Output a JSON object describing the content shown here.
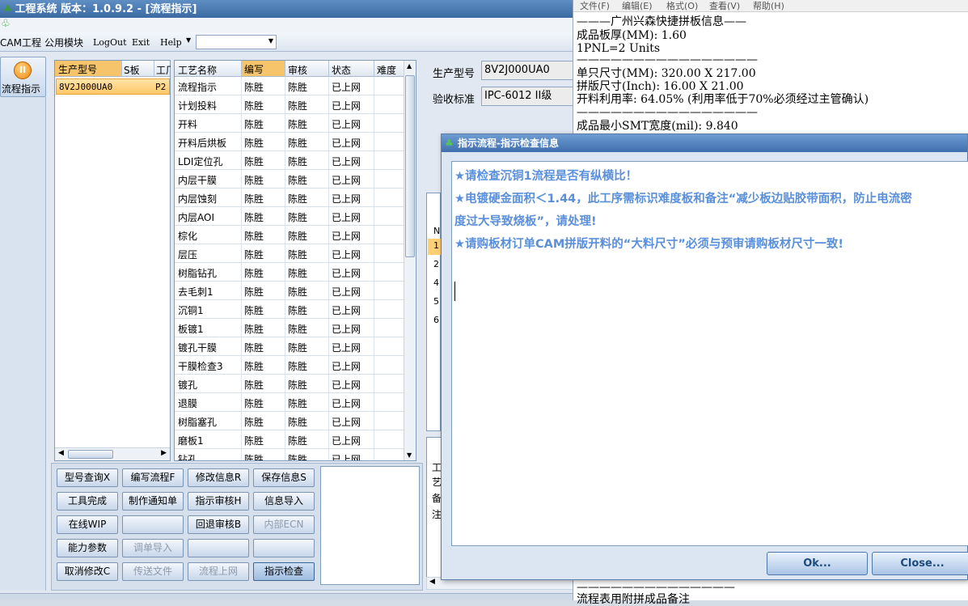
{
  "window": {
    "title": "工程系统    版本：1.0.9.2 - [流程指示]"
  },
  "menubar": {
    "items": [
      "CAM工程",
      "公用模块",
      "LogOut",
      "Exit",
      "Help"
    ]
  },
  "leftnav": {
    "label": "流程指示",
    "icon": "flow-icon"
  },
  "model_list": {
    "columns": [
      "生产型号",
      "S板",
      "工厂"
    ],
    "rows": [
      {
        "model": "8V2J000UA0",
        "s_board": "",
        "factory": "P2"
      }
    ]
  },
  "process_grid": {
    "columns": [
      "工艺名称",
      "编写",
      "审核",
      "状态",
      "难度"
    ],
    "rows": [
      {
        "name": "流程指示",
        "writer": "陈胜",
        "reviewer": "陈胜",
        "status": "已上网"
      },
      {
        "name": "计划投料",
        "writer": "陈胜",
        "reviewer": "陈胜",
        "status": "已上网"
      },
      {
        "name": "开料",
        "writer": "陈胜",
        "reviewer": "陈胜",
        "status": "已上网"
      },
      {
        "name": "开料后烘板",
        "writer": "陈胜",
        "reviewer": "陈胜",
        "status": "已上网"
      },
      {
        "name": "LDI定位孔",
        "writer": "陈胜",
        "reviewer": "陈胜",
        "status": "已上网"
      },
      {
        "name": "内层干膜",
        "writer": "陈胜",
        "reviewer": "陈胜",
        "status": "已上网"
      },
      {
        "name": "内层蚀刻",
        "writer": "陈胜",
        "reviewer": "陈胜",
        "status": "已上网"
      },
      {
        "name": "内层AOI",
        "writer": "陈胜",
        "reviewer": "陈胜",
        "status": "已上网"
      },
      {
        "name": "棕化",
        "writer": "陈胜",
        "reviewer": "陈胜",
        "status": "已上网"
      },
      {
        "name": "层压",
        "writer": "陈胜",
        "reviewer": "陈胜",
        "status": "已上网"
      },
      {
        "name": "树脂钻孔",
        "writer": "陈胜",
        "reviewer": "陈胜",
        "status": "已上网"
      },
      {
        "name": "去毛刺1",
        "writer": "陈胜",
        "reviewer": "陈胜",
        "status": "已上网"
      },
      {
        "name": "沉铜1",
        "writer": "陈胜",
        "reviewer": "陈胜",
        "status": "已上网"
      },
      {
        "name": "板镀1",
        "writer": "陈胜",
        "reviewer": "陈胜",
        "status": "已上网"
      },
      {
        "name": "镀孔干膜",
        "writer": "陈胜",
        "reviewer": "陈胜",
        "status": "已上网"
      },
      {
        "name": "干膜检查3",
        "writer": "陈胜",
        "reviewer": "陈胜",
        "status": "已上网"
      },
      {
        "name": "镀孔",
        "writer": "陈胜",
        "reviewer": "陈胜",
        "status": "已上网"
      },
      {
        "name": "退膜",
        "writer": "陈胜",
        "reviewer": "陈胜",
        "status": "已上网"
      },
      {
        "name": "树脂塞孔",
        "writer": "陈胜",
        "reviewer": "陈胜",
        "status": "已上网"
      },
      {
        "name": "磨板1",
        "writer": "陈胜",
        "reviewer": "陈胜",
        "status": "已上网"
      },
      {
        "name": "钻孔",
        "writer": "陈胜",
        "reviewer": "陈胜",
        "status": "已上网"
      }
    ]
  },
  "buttons": {
    "b1": "型号查询X",
    "b2": "编写流程F",
    "b3": "修改信息R",
    "b4": "保存信息S",
    "b5": "工具完成",
    "b6": "制作通知单",
    "b7": "指示审核H",
    "b8": "信息导入",
    "b9": "在线WIP",
    "b11": "回退审核B",
    "b12": "内部ECN",
    "b13": "能力参数",
    "b14": "调单导入",
    "b17": "取消修改C",
    "b18": "传送文件",
    "b19": "流程上网",
    "b20": "指示检查"
  },
  "right_fields": {
    "model_label": "生产型号",
    "model_value": "8V2J000UA0",
    "standard_label": "验收标准",
    "standard_value": "IPC-6012 II级",
    "row_labels": [
      "N",
      "1",
      "2",
      "4",
      "5",
      "6"
    ],
    "lower_labels": [
      "工",
      "艺",
      "备",
      "注"
    ]
  },
  "notepad": {
    "menu": [
      "文件(F)",
      "编辑(E)",
      "格式(O)",
      "查看(V)",
      "帮助(H)"
    ],
    "lines": [
      "———广州兴森快捷拼板信息——",
      "成品板厚(MM): 1.60",
      "1PNL=2 Units",
      "————————————————",
      "单只尺寸(MM): 320.00 X 217.00",
      "拼版尺寸(Inch): 16.00 X 21.00",
      "开料利用率: 64.05% (利用率低于70%必须经过主管确认)",
      "————————————————",
      "成品最小SMT宽度(mil): 9.840"
    ],
    "bottom_lines": [
      "——————————————",
      "     流程表用附拼成品备注"
    ]
  },
  "dialog": {
    "title": "指示流程-指示检查信息",
    "lines": [
      "★请检查沉铜1流程是否有纵横比！",
      "★电镀硬金面积＜1.44，此工序需标识难度板和备注“减少板边贴胶带面积，防止电流密",
      "度过大导致烧板”，请处理!",
      "★请购板材订单CAM拼版开料的“大料尺寸”必须与预审请购板材尺寸一致!"
    ],
    "ok_label": "Ok...",
    "close_label": "Close..."
  },
  "colors": {
    "accent": "#3f6fae",
    "selection": "#ffc766",
    "dialog_text": "#5a8fdb"
  }
}
